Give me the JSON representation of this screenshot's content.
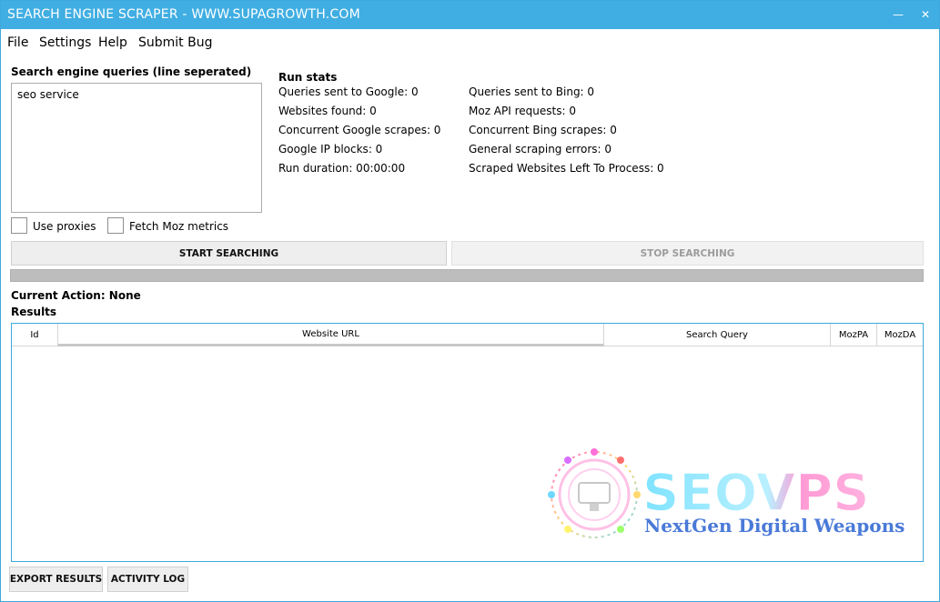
{
  "window": {
    "title": "SEARCH ENGINE SCRAPER - WWW.SUPAGROWTH.COM",
    "minimize_glyph": "—",
    "close_glyph": "✕",
    "accent_color": "#40aee2"
  },
  "menu": {
    "items": [
      "File",
      "Settings",
      "Help",
      "Submit Bug"
    ]
  },
  "queries": {
    "label": "Search engine queries (line seperated)",
    "value": "seo service"
  },
  "run_stats": {
    "title": "Run stats",
    "left": [
      "Queries sent to Google: 0",
      "Websites found: 0",
      "Concurrent Google scrapes: 0",
      "Google IP blocks: 0",
      "Run duration: 00:00:00"
    ],
    "right": [
      "Queries sent to Bing: 0",
      "Moz API requests: 0",
      "Concurrent Bing scrapes: 0",
      "General scraping errors: 0",
      "Scraped Websites Left To Process: 0"
    ]
  },
  "options": {
    "use_proxies": {
      "label": "Use proxies",
      "checked": false
    },
    "fetch_moz": {
      "label": "Fetch Moz metrics",
      "checked": false
    }
  },
  "actions": {
    "start": "START SEARCHING",
    "stop": "STOP SEARCHING"
  },
  "progress": {
    "value": 0
  },
  "status": {
    "current_action": "Current Action: None",
    "results_label": "Results"
  },
  "results_table": {
    "columns": [
      "Id",
      "Website URL",
      "Search Query",
      "MozPA",
      "MozDA"
    ],
    "rows": []
  },
  "footer": {
    "export": "EXPORT RESULTS",
    "log": "ACTIVITY LOG"
  },
  "watermark": {
    "brand": "SEOVPS",
    "tagline": "NextGen Digital Weapons"
  }
}
